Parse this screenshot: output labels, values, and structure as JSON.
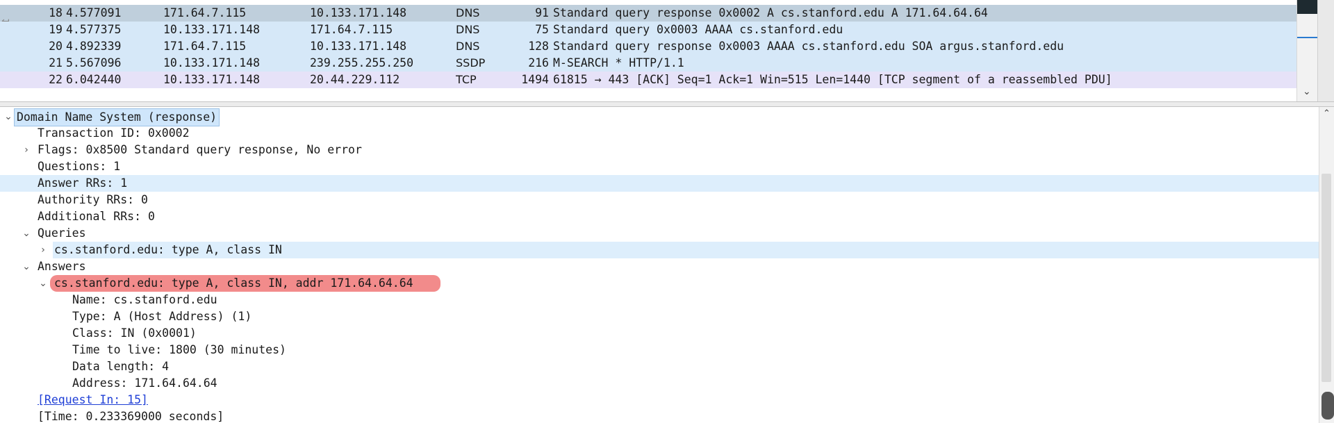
{
  "packet_list": {
    "rows": [
      {
        "no": "18",
        "time": "4.577091",
        "source": "171.64.7.115",
        "destination": "10.133.171.148",
        "protocol": "DNS",
        "length": "91",
        "info": "Standard query response 0x0002 A cs.stanford.edu A 171.64.64.64"
      },
      {
        "no": "19",
        "time": "4.577375",
        "source": "10.133.171.148",
        "destination": "171.64.7.115",
        "protocol": "DNS",
        "length": "75",
        "info": "Standard query 0x0003 AAAA cs.stanford.edu"
      },
      {
        "no": "20",
        "time": "4.892339",
        "source": "171.64.7.115",
        "destination": "10.133.171.148",
        "protocol": "DNS",
        "length": "128",
        "info": "Standard query response 0x0003 AAAA cs.stanford.edu SOA argus.stanford.edu"
      },
      {
        "no": "21",
        "time": "5.567096",
        "source": "10.133.171.148",
        "destination": "239.255.255.250",
        "protocol": "SSDP",
        "length": "216",
        "info": "M-SEARCH * HTTP/1.1"
      },
      {
        "no": "22",
        "time": "6.042440",
        "source": "10.133.171.148",
        "destination": "20.44.229.112",
        "protocol": "TCP",
        "length": "1494",
        "info": "61815 → 443 [ACK] Seq=1 Ack=1 Win=515 Len=1440 [TCP segment of a reassembled PDU]"
      }
    ],
    "related_marker": "↤"
  },
  "details": {
    "dns_header": "Domain Name System (response)",
    "transaction_id": "Transaction ID: 0x0002",
    "flags": "Flags: 0x8500 Standard query response, No error",
    "questions": "Questions: 1",
    "answer_rrs": "Answer RRs: 1",
    "authority_rrs": "Authority RRs: 0",
    "additional_rrs": "Additional RRs: 0",
    "queries_label": "Queries",
    "query_item": "cs.stanford.edu: type A, class IN",
    "answers_label": "Answers",
    "answer_item": "cs.stanford.edu: type A, class IN, addr 171.64.64.64",
    "answer_name": "Name: cs.stanford.edu",
    "answer_type": "Type: A (Host Address) (1)",
    "answer_class": "Class: IN (0x0001)",
    "answer_ttl": "Time to live: 1800 (30 minutes)",
    "answer_data_length": "Data length: 4",
    "answer_address": "Address: 171.64.64.64",
    "request_in": "[Request In: 15]",
    "time": "[Time: 0.233369000 seconds]"
  },
  "icons": {
    "expanded": "⌄",
    "collapsed": "›",
    "scroll_up": "⌃",
    "scroll_down": "⌄"
  },
  "colors": {
    "selected_row": "#bfcfdc",
    "dns_row": "#d6e8f8",
    "tcp_row": "#e6e2f8",
    "expert_highlight": "#f28b8b",
    "link": "#1f3fd6"
  }
}
